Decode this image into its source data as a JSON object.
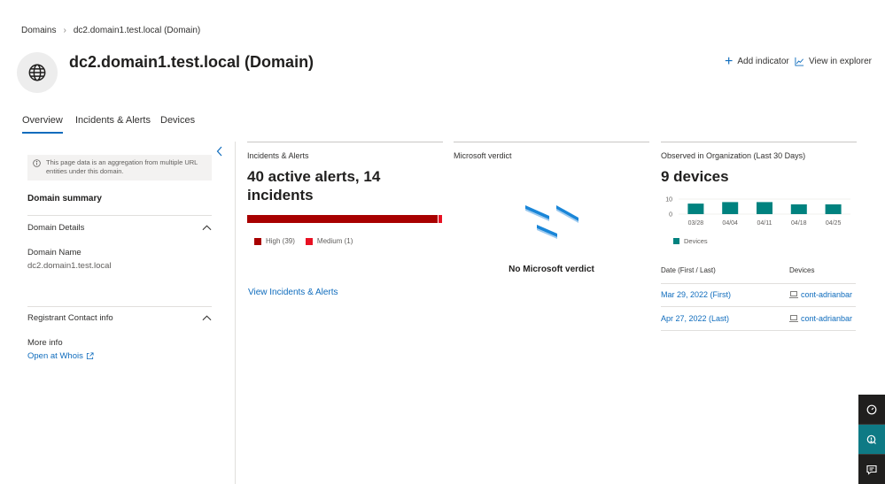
{
  "breadcrumb": {
    "root": "Domains",
    "current": "dc2.domain1.test.local (Domain)"
  },
  "header": {
    "title": "dc2.domain1.test.local (Domain)",
    "avatar_icon": "globe-icon",
    "add_indicator": "Add indicator",
    "view_explorer": "View in explorer"
  },
  "tabs": [
    {
      "label": "Overview",
      "active": true
    },
    {
      "label": "Incidents & Alerts"
    },
    {
      "label": "Devices"
    }
  ],
  "sidebar": {
    "notice": "This page data is an aggregation from multiple URL entities under this domain.",
    "summary_title": "Domain summary",
    "details_header": "Domain Details",
    "domain_name_label": "Domain Name",
    "domain_name_value": "dc2.domain1.test.local",
    "registrant_header": "Registrant Contact info",
    "more_info_label": "More info",
    "whois_link": "Open at Whois"
  },
  "incidents_card": {
    "title": "Incidents & Alerts",
    "headline": "40 active alerts, 14 incidents",
    "severity": [
      {
        "label": "High (39)",
        "count": 39,
        "color": "#a80000"
      },
      {
        "label": "Medium (1)",
        "count": 1,
        "color": "#e81123"
      }
    ],
    "link": "View Incidents & Alerts"
  },
  "verdict_card": {
    "title": "Microsoft verdict",
    "empty_text": "No Microsoft verdict"
  },
  "observed_card": {
    "title": "Observed in Organization (Last 30 Days)",
    "headline": "9 devices",
    "legend": "Devices",
    "col_date": "Date (First / Last)",
    "col_devices": "Devices",
    "rows": [
      {
        "date": "Mar 29, 2022 (First)",
        "device": "cont-adrianbar"
      },
      {
        "date": "Apr 27, 2022 (Last)",
        "device": "cont-adrianbar"
      }
    ]
  },
  "chart_data": {
    "type": "bar",
    "categories": [
      "03/28",
      "04/04",
      "04/11",
      "04/18",
      "04/25"
    ],
    "series": [
      {
        "name": "Devices",
        "values": [
          7,
          8,
          8,
          6.5,
          6.5
        ],
        "color": "#00827f"
      }
    ],
    "yticks": [
      0,
      10
    ],
    "ylim": [
      0,
      10
    ],
    "legend": "bottom-left"
  },
  "rail": {
    "items": [
      "feedback-icon",
      "help-icon",
      "chat-icon"
    ]
  }
}
